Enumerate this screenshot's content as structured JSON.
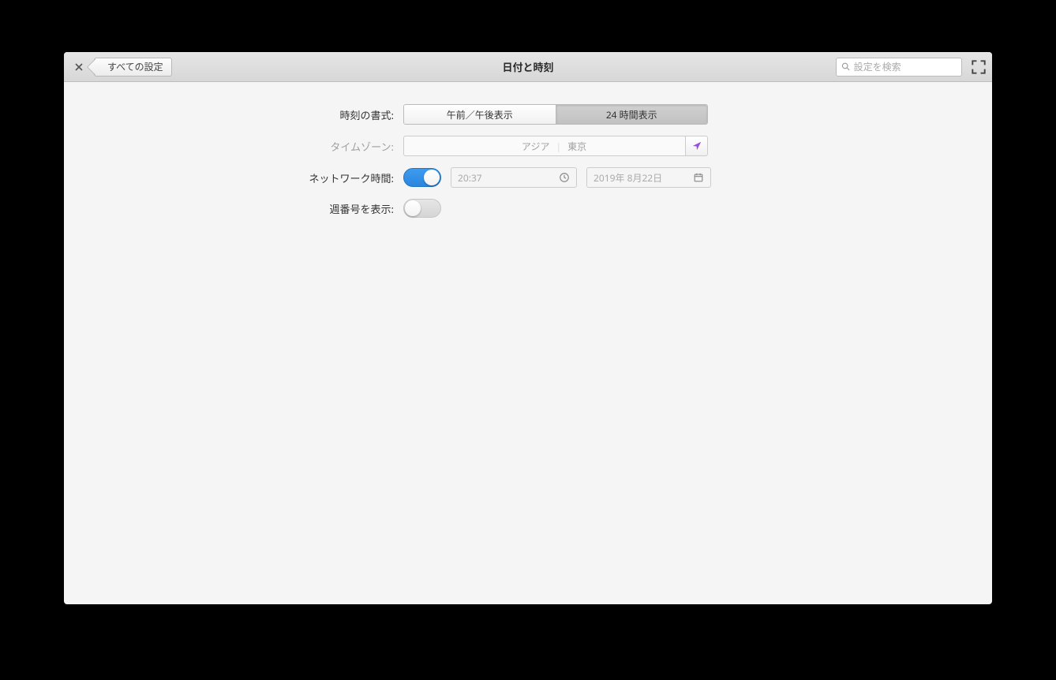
{
  "header": {
    "back_label": "すべての設定",
    "title": "日付と時刻",
    "search_placeholder": "設定を検索"
  },
  "form": {
    "time_format": {
      "label": "時刻の書式:",
      "option_ampm": "午前／午後表示",
      "option_24h": "24 時間表示"
    },
    "timezone": {
      "label": "タイムゾーン:",
      "region": "アジア",
      "city": "東京"
    },
    "network_time": {
      "label": "ネットワーク時間:",
      "time_value": "20:37",
      "date_value": "2019年 8月22日"
    },
    "week_numbers": {
      "label": "週番号を表示:"
    }
  },
  "colors": {
    "accent_purple": "#9a4fd6"
  }
}
